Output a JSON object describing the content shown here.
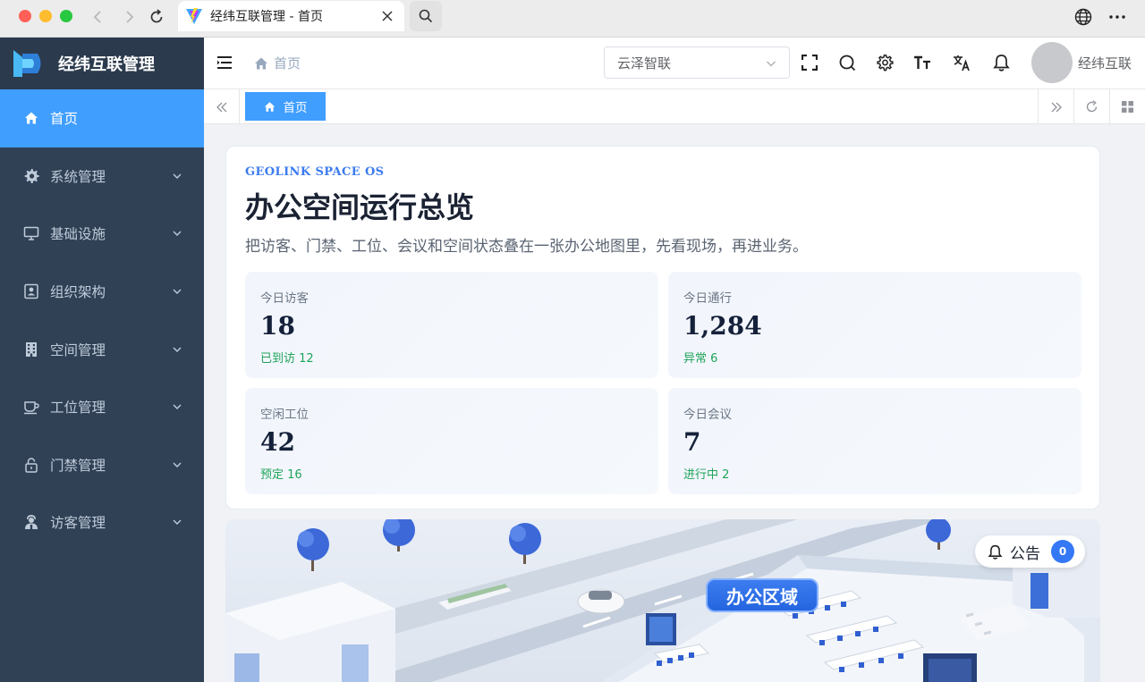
{
  "browser": {
    "tab_title": "经纬互联管理 - 首页"
  },
  "sidebar": {
    "brand": "经纬互联管理",
    "items": [
      {
        "label": "首页",
        "icon": "home-icon"
      },
      {
        "label": "系统管理",
        "icon": "gear-icon"
      },
      {
        "label": "基础设施",
        "icon": "monitor-icon"
      },
      {
        "label": "组织架构",
        "icon": "id-card-icon"
      },
      {
        "label": "空间管理",
        "icon": "building-icon"
      },
      {
        "label": "工位管理",
        "icon": "cup-icon"
      },
      {
        "label": "门禁管理",
        "icon": "lock-icon"
      },
      {
        "label": "访客管理",
        "icon": "visitor-icon"
      }
    ]
  },
  "header": {
    "breadcrumb": "首页",
    "tenant": "云泽智联",
    "user": "经纬互联"
  },
  "tags": {
    "home": "首页"
  },
  "overview": {
    "eyebrow": "GEOLINK SPACE OS",
    "title": "办公空间运行总览",
    "desc": "把访客、门禁、工位、会议和空间状态叠在一张办公地图里，先看现场，再进业务。",
    "stats": [
      {
        "label": "今日访客",
        "value": "18",
        "sub": "已到访 12"
      },
      {
        "label": "今日通行",
        "value": "1,284",
        "sub": "异常 6"
      },
      {
        "label": "空闲工位",
        "value": "42",
        "sub": "预定 16"
      },
      {
        "label": "今日会议",
        "value": "7",
        "sub": "进行中 2"
      }
    ]
  },
  "map": {
    "notice_label": "公告",
    "notice_count": "0",
    "area_label": "办公区域"
  },
  "colors": {
    "sidebar_bg": "#304156",
    "accent": "#409eff",
    "success": "#1fa35a"
  }
}
